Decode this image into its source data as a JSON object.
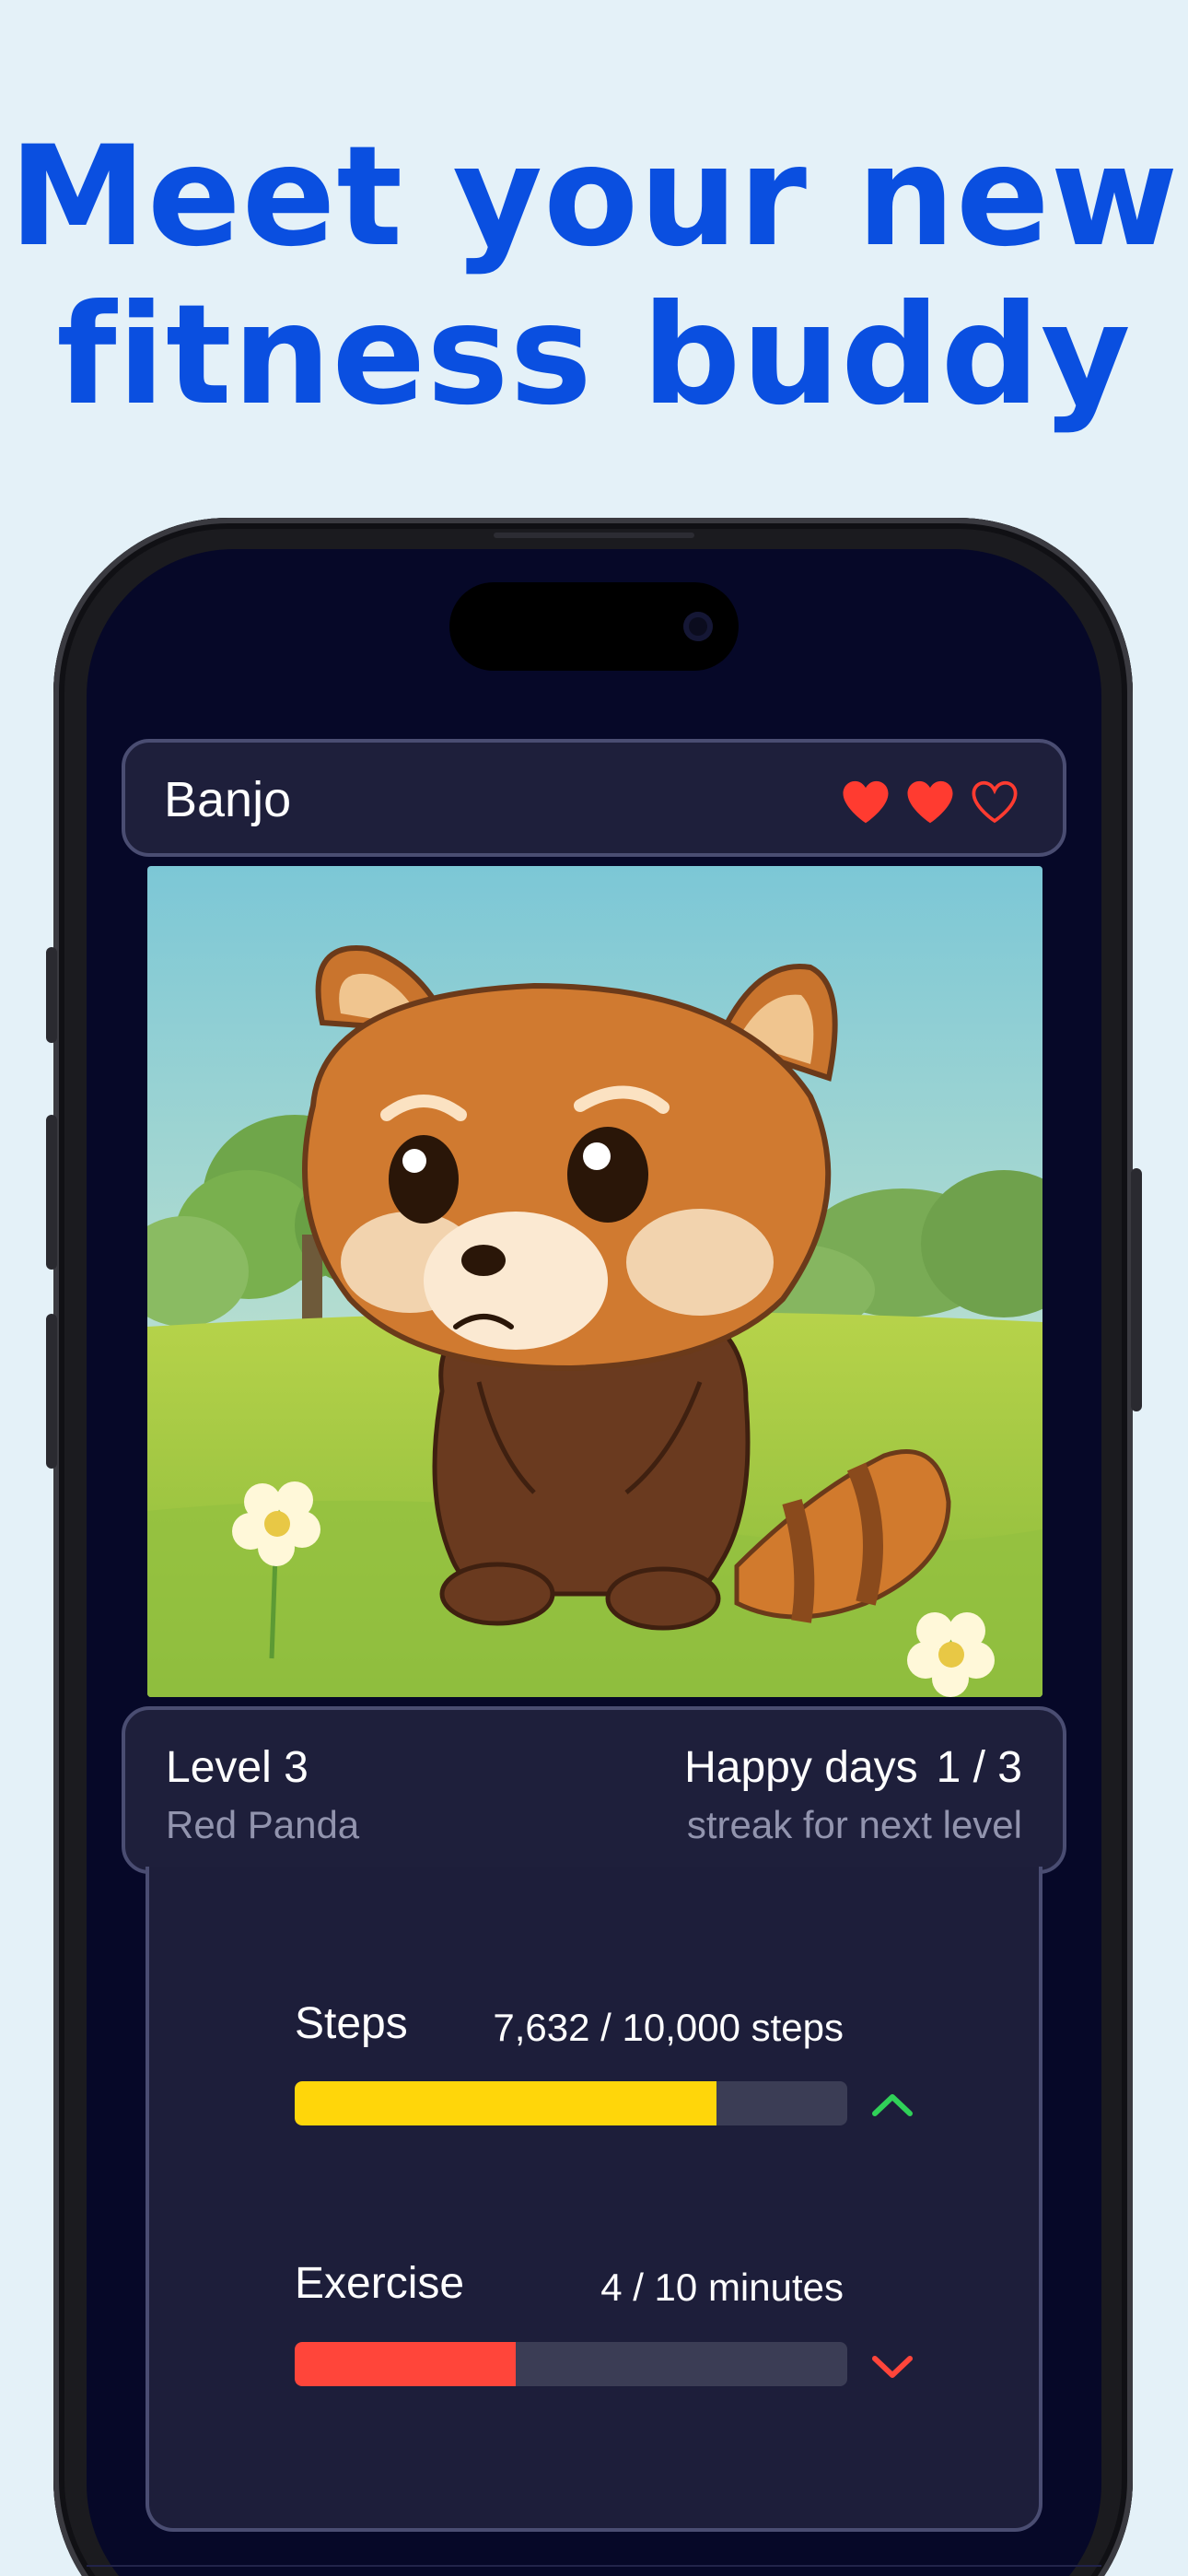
{
  "headline": {
    "line1": "Meet your new",
    "line2": "fitness buddy"
  },
  "pet": {
    "name": "Banjo",
    "hearts_total": 3,
    "hearts_filled": 2,
    "heart_color": "#ff3b30",
    "species_image": "red-panda-in-meadow"
  },
  "level": {
    "title": "Level 3",
    "species": "Red Panda",
    "happy_label": "Happy days",
    "happy_count": "1 / 3",
    "happy_sub": "streak for next level"
  },
  "stats": [
    {
      "label": "Steps",
      "value": "7,632 / 10,000 steps",
      "progress": 0.7632,
      "bar_color": "#ffd60a",
      "trend": "up",
      "trend_color": "#30d158"
    },
    {
      "label": "Exercise",
      "value": "4 / 10 minutes",
      "progress": 0.4,
      "bar_color": "#ff453a",
      "trend": "down",
      "trend_color": "#ff453a"
    }
  ],
  "colors": {
    "background": "#e4f1f8",
    "headline": "#0a4fe0",
    "screen": "#060828",
    "card": "#1e1f3b",
    "card_border": "#4a4d72"
  }
}
